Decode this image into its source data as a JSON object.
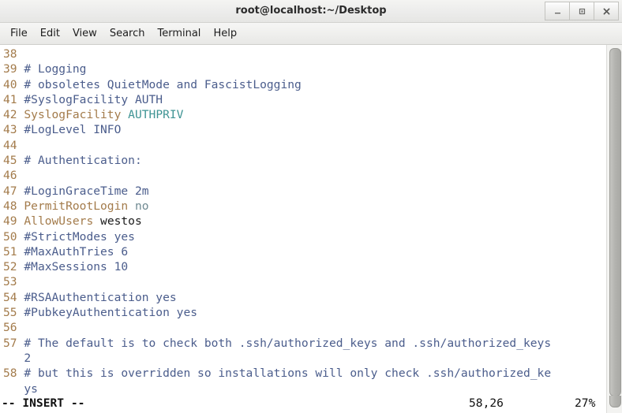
{
  "window": {
    "title": "root@localhost:~/Desktop",
    "buttons": [
      {
        "name": "minimize",
        "glyph": "_"
      },
      {
        "name": "maximize",
        "glyph": "□"
      },
      {
        "name": "close",
        "glyph": "×"
      }
    ]
  },
  "menubar": {
    "items": [
      {
        "label": "File"
      },
      {
        "label": "Edit"
      },
      {
        "label": "View"
      },
      {
        "label": "Search"
      },
      {
        "label": "Terminal"
      },
      {
        "label": "Help"
      }
    ]
  },
  "editor": {
    "lines": [
      {
        "num": "38",
        "segments": []
      },
      {
        "num": "39",
        "segments": [
          {
            "text": "# Logging",
            "style": "cmt"
          }
        ]
      },
      {
        "num": "40",
        "segments": [
          {
            "text": "# obsoletes QuietMode and FascistLogging",
            "style": "cmt"
          }
        ]
      },
      {
        "num": "41",
        "segments": [
          {
            "text": "#SyslogFacility AUTH",
            "style": "cmt"
          }
        ]
      },
      {
        "num": "42",
        "segments": [
          {
            "text": "SyslogFacility ",
            "style": "key"
          },
          {
            "text": "AUTHPRIV",
            "style": "val"
          }
        ]
      },
      {
        "num": "43",
        "segments": [
          {
            "text": "#LogLevel INFO",
            "style": "cmt"
          }
        ]
      },
      {
        "num": "44",
        "segments": []
      },
      {
        "num": "45",
        "segments": [
          {
            "text": "# Authentication:",
            "style": "cmt"
          }
        ]
      },
      {
        "num": "46",
        "segments": []
      },
      {
        "num": "47",
        "segments": [
          {
            "text": "#LoginGraceTime 2m",
            "style": "cmt"
          }
        ]
      },
      {
        "num": "48",
        "segments": [
          {
            "text": "PermitRootLogin ",
            "style": "key"
          },
          {
            "text": "no",
            "style": "valg"
          }
        ]
      },
      {
        "num": "49",
        "segments": [
          {
            "text": "AllowUsers ",
            "style": "key"
          },
          {
            "text": "westos",
            "style": "plain"
          }
        ]
      },
      {
        "num": "50",
        "segments": [
          {
            "text": "#StrictModes yes",
            "style": "cmt"
          }
        ]
      },
      {
        "num": "51",
        "segments": [
          {
            "text": "#MaxAuthTries 6",
            "style": "cmt"
          }
        ]
      },
      {
        "num": "52",
        "segments": [
          {
            "text": "#MaxSessions 10",
            "style": "cmt"
          }
        ]
      },
      {
        "num": "53",
        "segments": []
      },
      {
        "num": "54",
        "segments": [
          {
            "text": "#RSAAuthentication yes",
            "style": "cmt"
          }
        ]
      },
      {
        "num": "55",
        "segments": [
          {
            "text": "#PubkeyAuthentication yes",
            "style": "cmt"
          }
        ]
      },
      {
        "num": "56",
        "segments": []
      },
      {
        "num": "57",
        "segments": [
          {
            "text": "# The default is to check both .ssh/authorized_keys and .ssh/authorized_keys",
            "style": "cmt"
          }
        ]
      },
      {
        "num": "",
        "segments": [
          {
            "text": "2",
            "style": "cmt"
          }
        ]
      },
      {
        "num": "58",
        "segments": [
          {
            "text": "# but this is overridden so installations will only check .ssh/authorized_ke",
            "style": "cmt"
          }
        ]
      },
      {
        "num": "",
        "segments": [
          {
            "text": "ys",
            "style": "cmt"
          }
        ]
      }
    ]
  },
  "status": {
    "mode": "-- INSERT --",
    "position": "58,26",
    "percent": "27%"
  },
  "colors": {
    "line_number": "#a37b4b",
    "comment": "#4b5d8c",
    "keyword": "#a37b4b",
    "value": "#3f9494",
    "value_gray": "#6f8a92",
    "plain": "#1a1a1a",
    "background": "#ffffff",
    "chrome": "#eeeeec"
  }
}
